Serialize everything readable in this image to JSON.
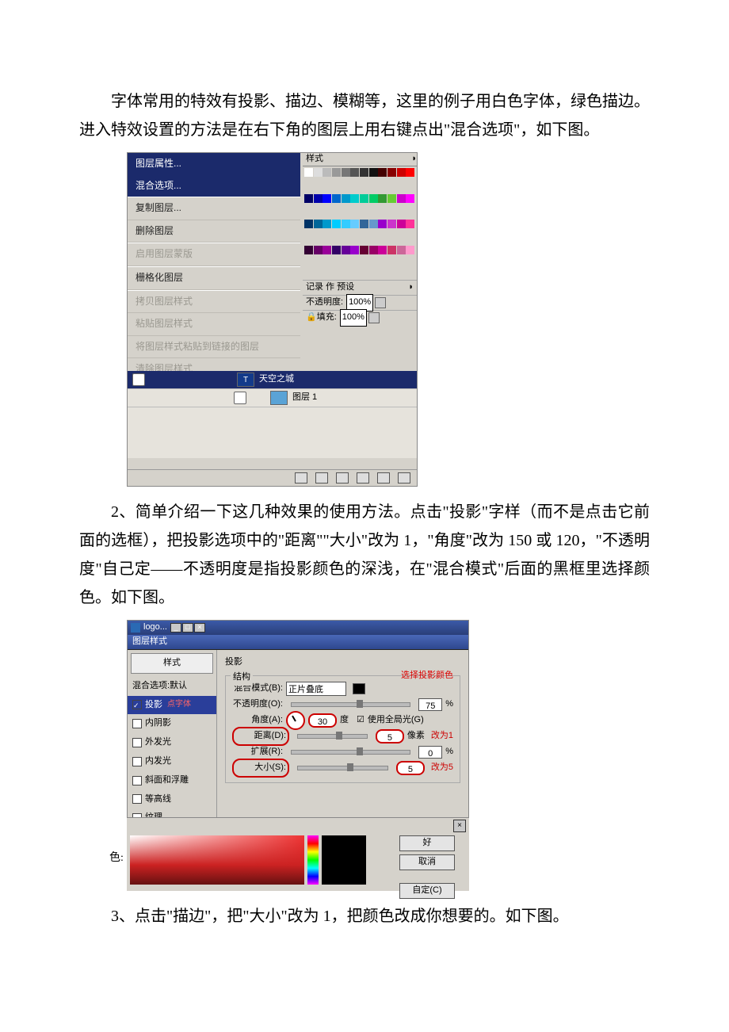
{
  "para1": "字体常用的特效有投影、描边、模糊等，这里的例子用白色字体，绿色描边。进入特效设置的方法是在右下角的图层上用右键点出\"混合选项\"，如下图。",
  "para2": "2、简单介绍一下这几种效果的使用方法。点击\"投影\"字样（而不是点击它前面的选框），把投影选项中的\"距离\"\"大小\"改为 1，\"角度\"改为 150 或 120，\"不透明度\"自己定——不透明度是指投影颜色的深浅，在\"混合模式\"后面的黑框里选择颜色。如下图。",
  "para3": "3、点击\"描边\"，把\"大小\"改为 1，把颜色改成你想要的。如下图。",
  "fig1": {
    "ctx": {
      "props": "图层属性...",
      "blend": "混合选项...",
      "dup": "复制图层...",
      "del": "删除图层",
      "mask": "启用图层蒙版",
      "raster": "栅格化图层",
      "copy": "拷贝图层样式",
      "paste": "粘贴图层样式",
      "pasteLinked": "将图层样式粘贴到链接的图层",
      "clear": "清除图层样式"
    },
    "swatchTab": "样式",
    "tabs": "记录  作  预设",
    "opacityLabel": "不透明度:",
    "opacityVal": "100%",
    "fillLabel": "填充:",
    "fillVal": "100%",
    "layerA": "天空之城",
    "layerB": "图层 1"
  },
  "fig2": {
    "winTitle": "logo...",
    "dlgTitle": "图层样式",
    "listHead": "样式",
    "listDefault": "混合选项:默认",
    "listShadow": "投影",
    "listShadowNote": "点字体",
    "listInner": "内阴影",
    "listOuterGlow": "外发光",
    "listInnerGlow": "内发光",
    "listBevel": "斜面和浮雕",
    "listContour": "等高线",
    "listTexture": "纹理",
    "secTitle": "投影",
    "grpTitle": "结构",
    "redTop": "选择投影颜色",
    "blendMode": "混合模式(B):",
    "blendVal": "正片叠底",
    "opacity": "不透明度(O):",
    "opacityVal": "75",
    "pct": "%",
    "angle": "角度(A):",
    "angleVal": "30",
    "deg": "度",
    "globalLight": "使用全局光(G)",
    "distance": "距离(D):",
    "distanceVal": "5",
    "px": "像素",
    "redChange1": "改为1",
    "spread": "扩展(R):",
    "spreadVal": "0",
    "size": "大小(S):",
    "sizeVal": "5",
    "redChange5": "改为5",
    "pickerLabel": "色:",
    "btnOk": "好",
    "btnCancel": "取消",
    "btnCustom": "自定(C)"
  }
}
